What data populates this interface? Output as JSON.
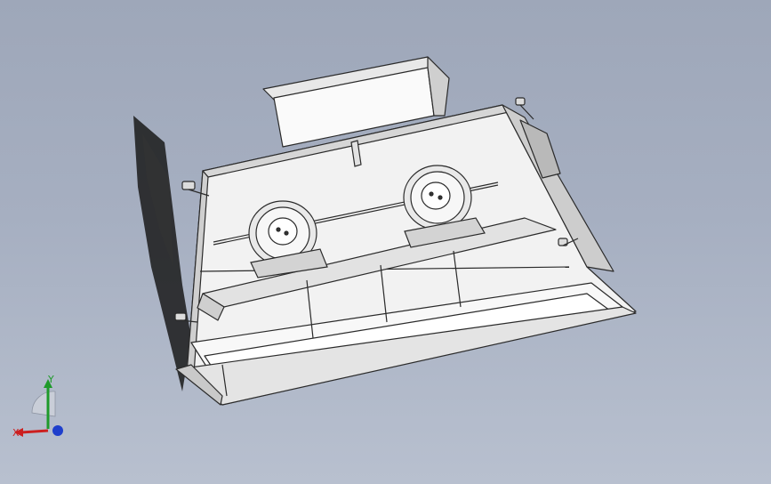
{
  "viewport": {
    "background_top": "#9ea7b9",
    "background_bottom": "#b8c0cf"
  },
  "model": {
    "name_icon": "hopper-assembly-icon",
    "edge_color": "#2b2b2b",
    "face_color": "#f4f4f4",
    "shade_color": "#d8d8d8"
  },
  "triad": {
    "x_label": "X",
    "y_label": "Y",
    "x_color": "#cc1f1f",
    "y_color": "#1e9a2a",
    "z_color": "#1f3fcc"
  }
}
